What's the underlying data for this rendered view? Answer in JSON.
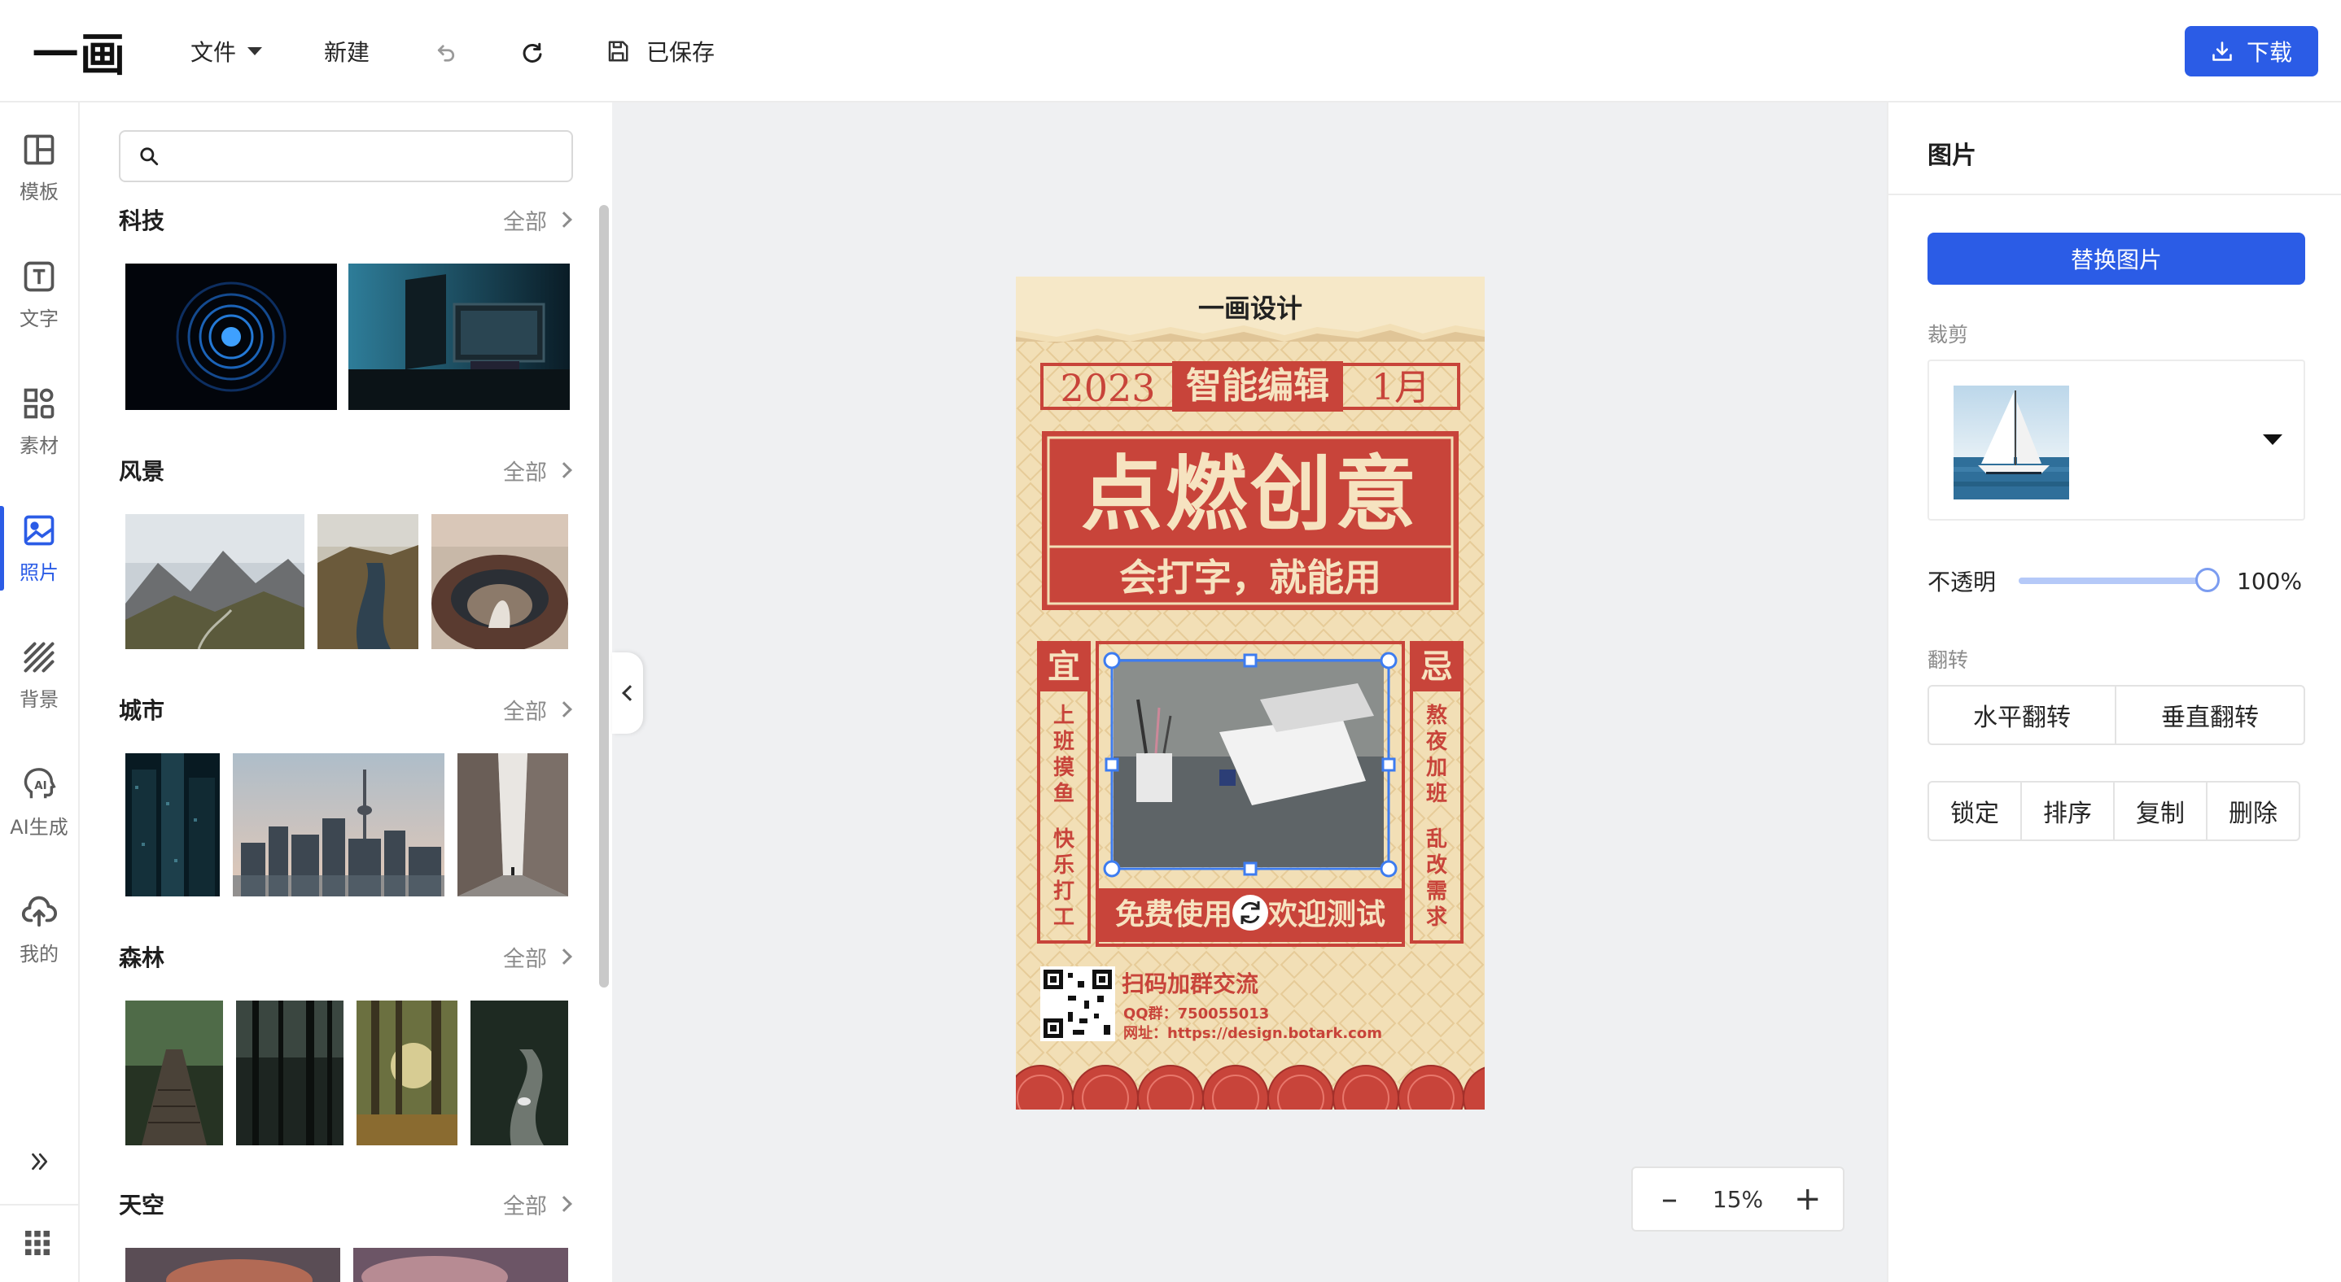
{
  "app": {
    "logo": "一画"
  },
  "toolbar": {
    "file_label": "文件",
    "new_label": "新建",
    "saved_label": "已保存",
    "download_label": "下载"
  },
  "nav": {
    "items": [
      {
        "id": "template",
        "label": "模板",
        "icon": "layout-icon"
      },
      {
        "id": "text",
        "label": "文字",
        "icon": "text-icon"
      },
      {
        "id": "material",
        "label": "素材",
        "icon": "shapes-icon"
      },
      {
        "id": "photo",
        "label": "照片",
        "icon": "image-icon",
        "active": true
      },
      {
        "id": "background",
        "label": "背景",
        "icon": "stripes-icon"
      },
      {
        "id": "ai",
        "label": "AI生成",
        "icon": "ai-head-icon"
      },
      {
        "id": "mine",
        "label": "我的",
        "icon": "cloud-upload-icon"
      }
    ]
  },
  "panel": {
    "search_placeholder": "",
    "all_label": "全部",
    "categories": [
      {
        "title": "科技"
      },
      {
        "title": "风景"
      },
      {
        "title": "城市"
      },
      {
        "title": "森林"
      },
      {
        "title": "天空"
      }
    ]
  },
  "poster": {
    "brand": "一画设计",
    "year": "2023",
    "tag": "智能编辑",
    "month": "1月",
    "headline": "点燃创意",
    "subline": "会打字，就能用",
    "yi": "宜",
    "ji": "忌",
    "yi_col1": "上班摸鱼",
    "yi_col2": "快乐打工",
    "ji_col1": "熬夜加班",
    "ji_col2": "乱改需求",
    "bottom_banner_left": "免费使用",
    "bottom_banner_right": "欢迎测试",
    "qr_title": "扫码加群交流",
    "qq": "QQ群：750055013",
    "url": "网址：https://design.botark.com"
  },
  "zoom": {
    "value": "15%",
    "minus": "–",
    "plus": "+"
  },
  "properties": {
    "title": "图片",
    "replace_label": "替换图片",
    "crop_label": "裁剪",
    "opacity_label": "不透明",
    "opacity_value": "100%",
    "opacity_fraction": 1.0,
    "flip_label": "翻转",
    "flip_h": "水平翻转",
    "flip_v": "垂直翻转",
    "lock": "锁定",
    "order": "排序",
    "copy": "复制",
    "delete": "删除"
  },
  "colors": {
    "accent": "#2b5ce6",
    "poster_red": "#c8443a",
    "poster_paper": "#f2dfb6"
  }
}
